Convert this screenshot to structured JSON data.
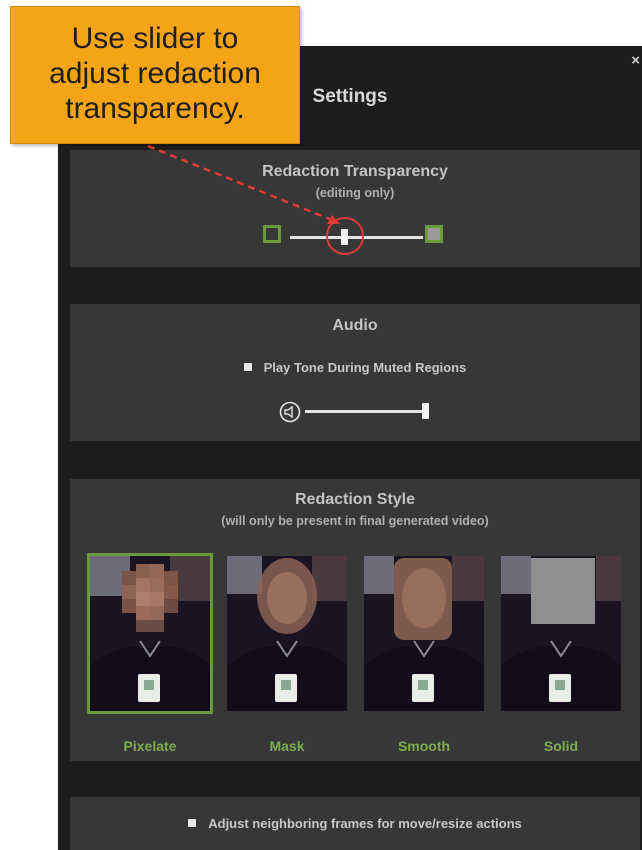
{
  "callout": {
    "line1": "Use slider to",
    "line2": "adjust redaction",
    "line3": "transparency.",
    "color": "#f5a418"
  },
  "panel": {
    "title": "Settings",
    "close_glyph": "×"
  },
  "transparency": {
    "title": "Redaction Transparency",
    "subtitle": "(editing only)",
    "value": 0.41,
    "accent_color": "#6a9a3c",
    "highlight_color": "#e03a3a"
  },
  "audio": {
    "title": "Audio",
    "checkbox_label": "Play Tone During Muted Regions",
    "volume": 1.0,
    "speaker_icon": "speaker-icon"
  },
  "style": {
    "title": "Redaction Style",
    "subtitle": "(will only be present in final generated video)",
    "options": [
      {
        "label": "Pixelate",
        "selected": true
      },
      {
        "label": "Mask",
        "selected": false
      },
      {
        "label": "Smooth",
        "selected": false
      },
      {
        "label": "Solid",
        "selected": false
      }
    ],
    "label_color": "#7db04a"
  },
  "neighbor": {
    "checkbox_label": "Adjust neighboring frames for move/resize actions"
  }
}
